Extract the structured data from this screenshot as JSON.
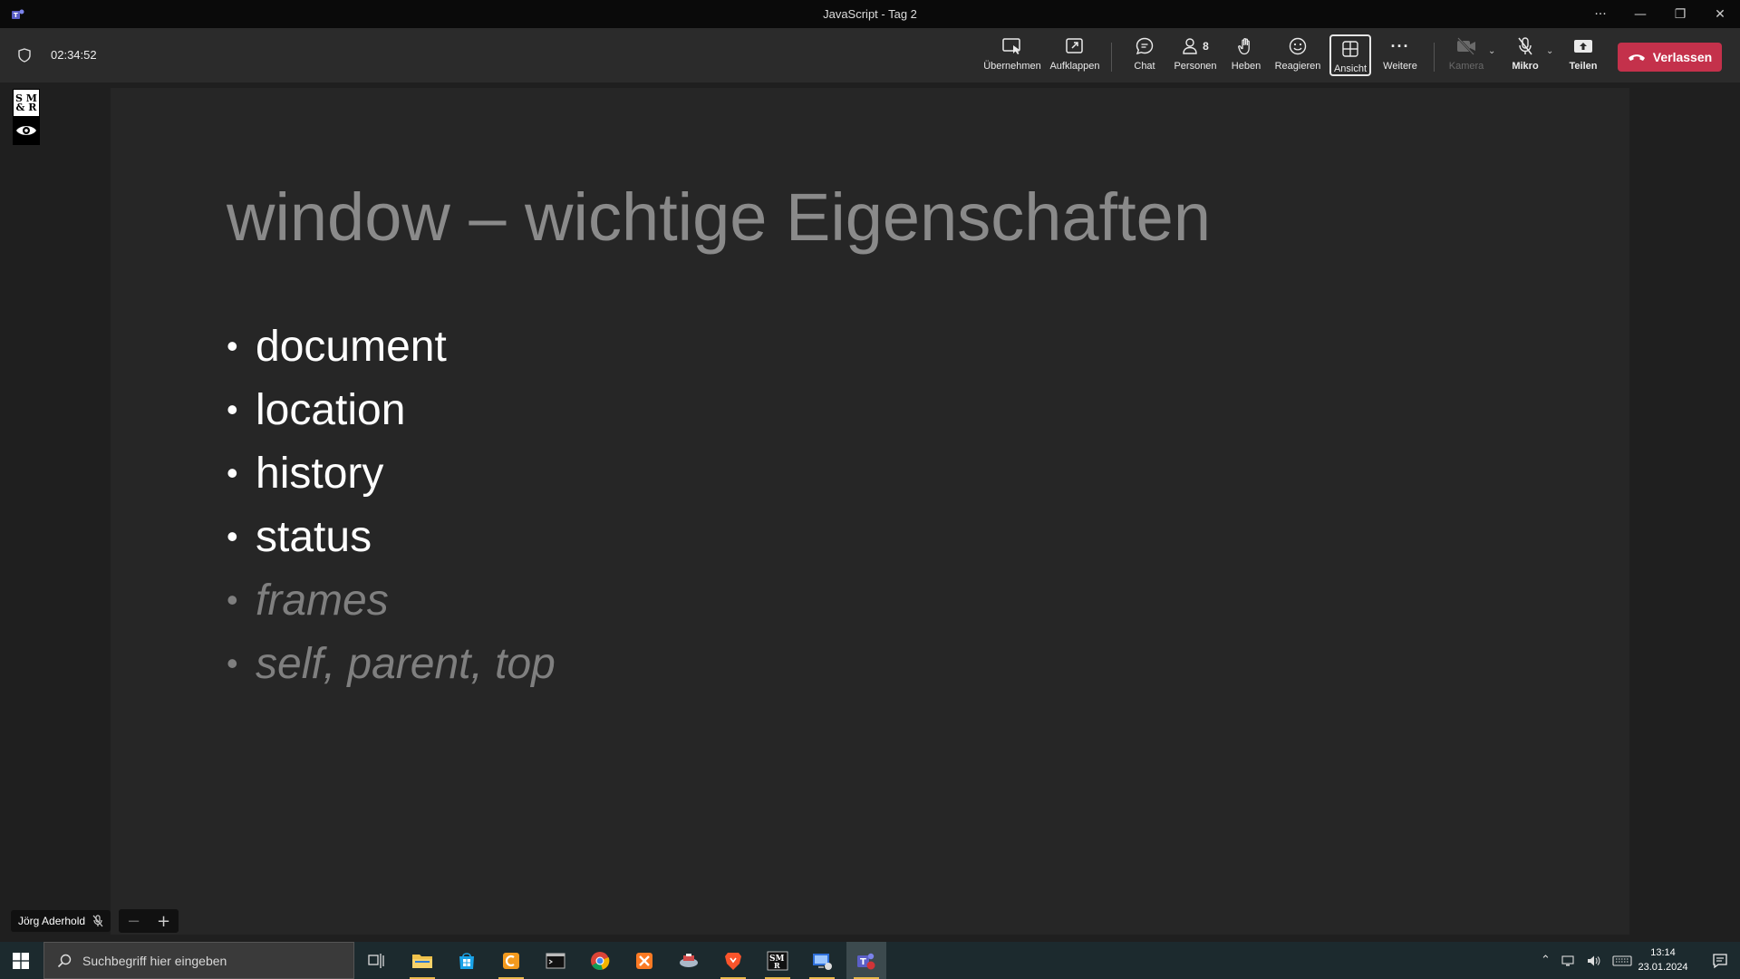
{
  "window": {
    "title": "JavaScript - Tag 2",
    "controls": {
      "more": "···",
      "minimize": "—",
      "restore": "❐",
      "close": "✕"
    }
  },
  "toolbar": {
    "timer": "02:34:52",
    "buttons": {
      "uebernehmen": "Übernehmen",
      "aufklappen": "Aufklappen",
      "chat": "Chat",
      "personen": "Personen",
      "personen_count": "8",
      "heben": "Heben",
      "reagieren": "Reagieren",
      "ansicht": "Ansicht",
      "weitere": "Weitere",
      "kamera": "Kamera",
      "mikro": "Mikro",
      "teilen": "Teilen"
    },
    "leave_label": "Verlassen",
    "leave_color": "#c4314b"
  },
  "slide": {
    "title": "window – wichtige Eigenschaften",
    "bullets": [
      {
        "text": "document",
        "dimmed": false
      },
      {
        "text": "location",
        "dimmed": false
      },
      {
        "text": "history",
        "dimmed": false
      },
      {
        "text": "status",
        "dimmed": false
      },
      {
        "text": "frames",
        "dimmed": true
      },
      {
        "text": "self, parent, top",
        "dimmed": true
      }
    ],
    "bullet_char": "•"
  },
  "presenter": {
    "name": "Jörg Aderhold",
    "zoom_minus": "−",
    "zoom_plus": "+"
  },
  "logo": {
    "text": "S M & R"
  },
  "taskbar": {
    "search_placeholder": "Suchbegriff hier eingeben",
    "time": "13:14",
    "date": "23.01.2024",
    "apps": [
      "task-view",
      "file-explorer",
      "microsoft-store",
      "app-orange",
      "terminal",
      "chrome",
      "xampp",
      "app-ship",
      "brave",
      "smr-app",
      "app-blue",
      "teams"
    ]
  }
}
